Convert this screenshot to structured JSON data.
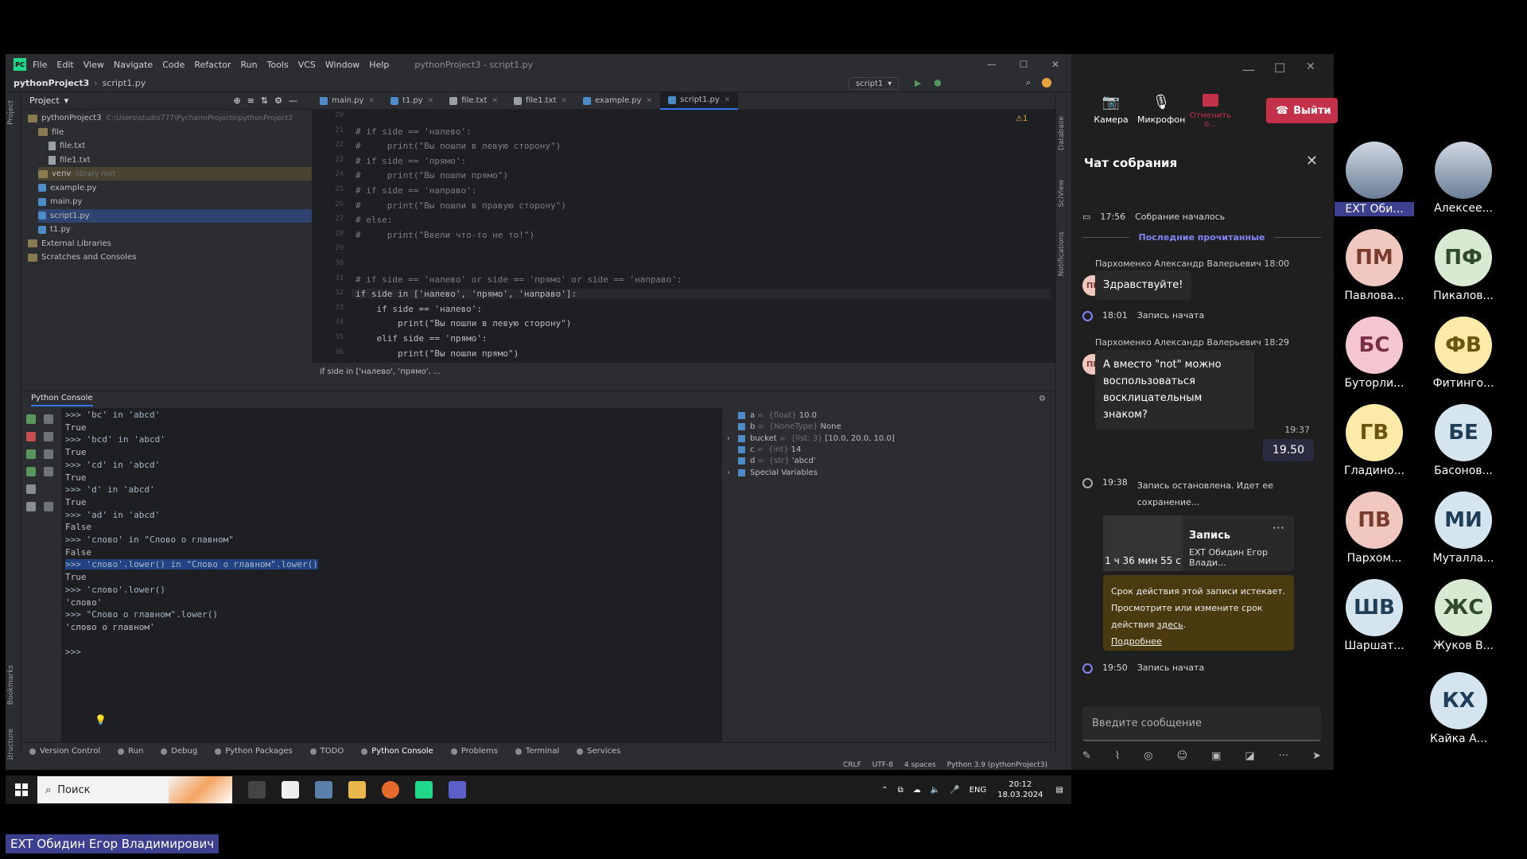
{
  "ide": {
    "menu": [
      "File",
      "Edit",
      "View",
      "Navigate",
      "Code",
      "Refactor",
      "Run",
      "Tools",
      "VCS",
      "Window",
      "Help"
    ],
    "window_title": "pythonProject3 - script1.py",
    "breadcrumb_project": "pythonProject3",
    "breadcrumb_file": "script1.py",
    "run_config": "script1",
    "project_label": "Project",
    "tree": [
      {
        "label": "pythonProject3",
        "detail": "C:\\Users\\studio777\\PycharmProjects\\pythonProject3",
        "kind": "folder",
        "indent": 0
      },
      {
        "label": "file",
        "kind": "folder",
        "indent": 1
      },
      {
        "label": "file.txt",
        "kind": "txt",
        "indent": 2
      },
      {
        "label": "file1.txt",
        "kind": "txt",
        "indent": 2
      },
      {
        "label": "venv",
        "detail": "library root",
        "kind": "folder",
        "indent": 1
      },
      {
        "label": "example.py",
        "kind": "py",
        "indent": 1
      },
      {
        "label": "main.py",
        "kind": "py",
        "indent": 1
      },
      {
        "label": "script1.py",
        "kind": "py",
        "indent": 1
      },
      {
        "label": "t1.py",
        "kind": "py",
        "indent": 1
      },
      {
        "label": "External Libraries",
        "kind": "folder",
        "indent": 0
      },
      {
        "label": "Scratches and Consoles",
        "kind": "folder",
        "indent": 0
      }
    ],
    "tabs": [
      "main.py",
      "t1.py",
      "file.txt",
      "file1.txt",
      "example.py",
      "script1.py"
    ],
    "active_tab": "script1.py",
    "code_lines": [
      {
        "n": "20",
        "t": ""
      },
      {
        "n": "21",
        "t": "# if side == 'налево':"
      },
      {
        "n": "22",
        "t": "#     print(\"Вы пошли в левую сторону\")"
      },
      {
        "n": "23",
        "t": "# if side == 'прямо':"
      },
      {
        "n": "24",
        "t": "#     print(\"Вы пошли прямо\")"
      },
      {
        "n": "25",
        "t": "# if side == 'направо':"
      },
      {
        "n": "26",
        "t": "#     print(\"Вы пошли в правую сторону\")"
      },
      {
        "n": "27",
        "t": "# else:"
      },
      {
        "n": "28",
        "t": "#     print(\"Ввели что-то не то!\")"
      },
      {
        "n": "29",
        "t": ""
      },
      {
        "n": "30",
        "t": ""
      },
      {
        "n": "31",
        "t": "# if side == 'налево' or side == 'прямо' or side == 'направо':"
      },
      {
        "n": "32",
        "t": "if side in ['налево', 'прямо', 'направо']:"
      },
      {
        "n": "33",
        "t": "    if side == 'налево':"
      },
      {
        "n": "34",
        "t": "        print(\"Вы пошли в левую сторону\")"
      },
      {
        "n": "35",
        "t": "    elif side == 'прямо':"
      },
      {
        "n": "36",
        "t": "        print(\"Вы пошли прямо\")"
      }
    ],
    "warning_count": "1",
    "editor_breadcrumb": "if side in ['налево', 'прямо', ...",
    "console_tab": "Python Console",
    "console_lines": [
      {
        "t": ">>> 'bc' in 'abcd'",
        "p": true
      },
      {
        "t": "True",
        "p": false
      },
      {
        "t": ">>> 'bcd' in 'abcd'",
        "p": true
      },
      {
        "t": "True",
        "p": false
      },
      {
        "t": ">>> 'cd' in 'abcd'",
        "p": true
      },
      {
        "t": "True",
        "p": false
      },
      {
        "t": ">>> 'd' in 'abcd'",
        "p": true
      },
      {
        "t": "True",
        "p": false
      },
      {
        "t": ">>> 'ad' in 'abcd'",
        "p": true
      },
      {
        "t": "False",
        "p": false
      },
      {
        "t": ">>> 'слово' in \"Слово о главном\"",
        "p": true
      },
      {
        "t": "False",
        "p": false
      },
      {
        "t": ">>> 'слово'.lower() in \"Слово о главном\".lower()",
        "p": true,
        "sel": true
      },
      {
        "t": "True",
        "p": false
      },
      {
        "t": ">>> 'слово'.lower()",
        "p": true
      },
      {
        "t": "'слово'",
        "p": false
      },
      {
        "t": ">>> \"Слово о главном\".lower()",
        "p": true
      },
      {
        "t": "'слово о главном'",
        "p": false
      },
      {
        "t": "",
        "p": false
      },
      {
        "t": ">>>",
        "p": true
      }
    ],
    "variables": [
      {
        "name": "a",
        "type": "{float}",
        "value": "10.0"
      },
      {
        "name": "b",
        "type": "{NoneType}",
        "value": "None"
      },
      {
        "name": "bucket",
        "type": "{list: 3}",
        "value": "[10.0, 20.0, 10.0]"
      },
      {
        "name": "c",
        "type": "{int}",
        "value": "14"
      },
      {
        "name": "d",
        "type": "{str}",
        "value": "'abcd'"
      },
      {
        "name": "Special Variables",
        "type": "",
        "value": ""
      }
    ],
    "bottom_tabs": [
      "Version Control",
      "Run",
      "Debug",
      "Python Packages",
      "TODO",
      "Python Console",
      "Problems",
      "Terminal",
      "Services"
    ],
    "status": [
      "CRLF",
      "UTF-8",
      "4 spaces",
      "Python 3.9 (pythonProject3)"
    ],
    "side_labels": {
      "project": "Project",
      "bookmarks": "Bookmarks",
      "structure": "Structure",
      "database": "Database",
      "sciview": "SciView",
      "notifications": "Notifications"
    }
  },
  "taskbar": {
    "search_placeholder": "Поиск",
    "lang": "ENG",
    "time": "20:12",
    "date": "18.03.2024"
  },
  "teams": {
    "controls": {
      "camera": "Камера",
      "mic": "Микрофон",
      "cancel": "Отменить о...",
      "leave": "Выйти"
    },
    "chat_title": "Чат собрания",
    "meeting_started": {
      "time": "17:56",
      "text": "Собрание началось"
    },
    "last_read": "Последние прочитанные",
    "msg1": {
      "sender": "Пархоменко Александр Валерьевич",
      "time": "18:00",
      "text": "Здравствуйте!"
    },
    "rec1": {
      "time": "18:01",
      "text": "Запись начата"
    },
    "msg2": {
      "sender": "Пархоменко Александр Валерьевич",
      "time": "18:29",
      "text": "А вместо \"not\" можно воспользоваться восклицательным знаком?"
    },
    "my_time": "19:37",
    "my_msg": "19.50",
    "rec_stop": {
      "time": "19:38",
      "text": "Запись остановлена. Идет ее сохранение..."
    },
    "rec_card": {
      "duration": "1 ч 36 мин 55 с",
      "title": "Запись",
      "owner": "EXT Обидин Егор Влади..."
    },
    "warn": {
      "text": "Срок действия этой записи истекает. Просмотрите или измените срок действия",
      "link": "здесь",
      "more": "Подробнее"
    },
    "rec2": {
      "time": "19:50",
      "text": "Запись начата"
    },
    "input_placeholder": "Введите сообщение",
    "avatar_initials": "ПВ"
  },
  "participants": [
    {
      "initials": "",
      "name": "EXT Оби...",
      "photo": true,
      "bg": "#3d3f8f"
    },
    {
      "initials": "",
      "name": "Алексее...",
      "photo": true,
      "bg": ""
    },
    {
      "initials": "ПМ",
      "name": "Павлова...",
      "bg": "#f0c8c0",
      "fg": "#7a3b2e"
    },
    {
      "initials": "ПФ",
      "name": "Пикалов...",
      "bg": "#d9ead3",
      "fg": "#2f4b2a"
    },
    {
      "initials": "БС",
      "name": "Буторли...",
      "bg": "#f4c6d0",
      "fg": "#7a2e45"
    },
    {
      "initials": "ФВ",
      "name": "Фитинго...",
      "bg": "#fde9a8",
      "fg": "#6b5310"
    },
    {
      "initials": "ГВ",
      "name": "Гладино...",
      "bg": "#fde9a8",
      "fg": "#6b5310"
    },
    {
      "initials": "БЕ",
      "name": "Басонов...",
      "bg": "#d5e5f0",
      "fg": "#1f3e58"
    },
    {
      "initials": "ПВ",
      "name": "Пархом...",
      "bg": "#f0c8c0",
      "fg": "#7a3b2e"
    },
    {
      "initials": "МИ",
      "name": "Муталла...",
      "bg": "#d5e5f0",
      "fg": "#1f3e58"
    },
    {
      "initials": "ШВ",
      "name": "Шаршат...",
      "bg": "#d5e5f0",
      "fg": "#1f3e58"
    },
    {
      "initials": "ЖС",
      "name": "Жуков В...",
      "bg": "#d9ead3",
      "fg": "#2f4b2a"
    },
    {
      "initials": "КХ",
      "name": "Кайка А...",
      "bg": "#d5e5f0",
      "fg": "#1f3e58"
    }
  ],
  "presenter_name": "EXT Обидин Егор Владимирович"
}
